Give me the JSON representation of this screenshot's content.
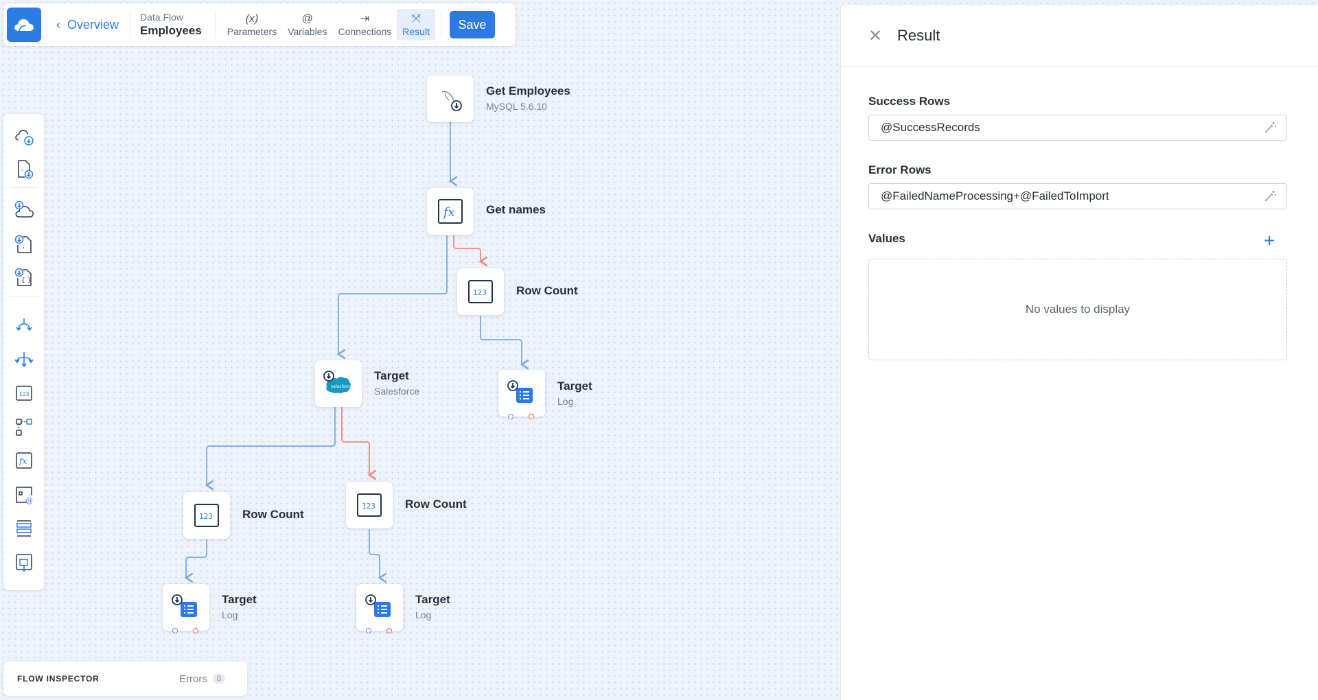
{
  "toolbar": {
    "back_label": "Overview",
    "flow_kind": "Data Flow",
    "flow_name": "Employees",
    "tabs": [
      {
        "glyph": "(x)",
        "label": "Parameters"
      },
      {
        "glyph": "@",
        "label": "Variables"
      },
      {
        "glyph": "⇥",
        "label": "Connections"
      },
      {
        "glyph": "⤧",
        "label": "Result"
      }
    ],
    "active_tab": "Result",
    "save_label": "Save"
  },
  "palette": {
    "items": [
      "cloud-source-icon",
      "csv-source-icon",
      "cloud-lookup-icon",
      "csv-lookup-icon",
      "json-lookup-icon",
      "split-icon",
      "merge-icon",
      "row-count-icon",
      "conditional-split-icon",
      "expression-icon",
      "extend-icon",
      "buffer-icon",
      "target-icon"
    ]
  },
  "nodes": {
    "get_employees": {
      "label": "Get Employees",
      "sub": "MySQL 5.6.10"
    },
    "get_names": {
      "label": "Get names"
    },
    "row_count_1": {
      "label": "Row Count"
    },
    "target_salesforce": {
      "label": "Target",
      "sub": "Salesforce",
      "badge": "salesforce"
    },
    "target_log_1": {
      "label": "Target",
      "sub": "Log"
    },
    "row_count_2": {
      "label": "Row Count"
    },
    "row_count_3": {
      "label": "Row Count"
    },
    "target_log_2": {
      "label": "Target",
      "sub": "Log"
    },
    "target_log_3": {
      "label": "Target",
      "sub": "Log"
    }
  },
  "colors": {
    "accent": "#2c7be5",
    "success_edge": "#7aaae8",
    "error_edge": "#ef8a7c"
  },
  "inspector": {
    "title": "FLOW INSPECTOR",
    "errors_label": "Errors",
    "errors_count": "0"
  },
  "result": {
    "title": "Result",
    "success_label": "Success Rows",
    "success_value": "@SuccessRecords",
    "error_label": "Error Rows",
    "error_value": "@FailedNameProcessing+@FailedToImport",
    "values_label": "Values",
    "values_empty": "No values to display"
  }
}
